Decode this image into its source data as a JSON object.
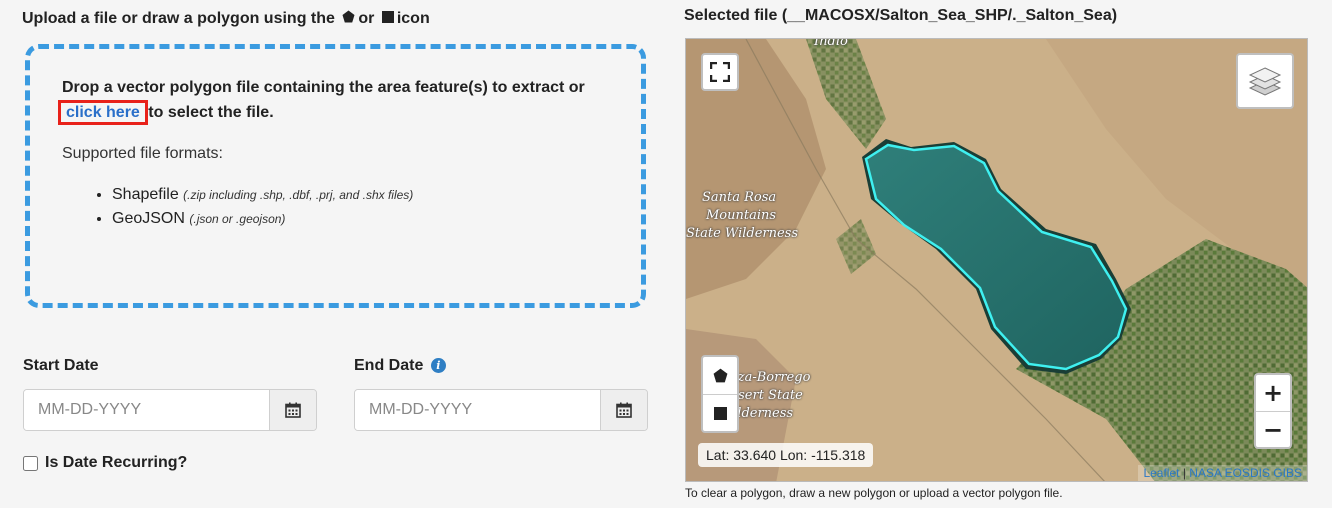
{
  "upload": {
    "heading_prefix": "Upload a file or draw a polygon using the",
    "heading_or": "or",
    "heading_suffix": "icon",
    "drop_text_before": "Drop a vector polygon file containing the area feature(s) to extract or ",
    "click_here": "click here",
    "drop_text_after": " to select the file.",
    "supported_formats_label": "Supported file formats:",
    "formats": [
      {
        "name": "Shapefile",
        "detail": "(.zip including .shp, .dbf, .prj, and .shx files)"
      },
      {
        "name": "GeoJSON",
        "detail": "(.json or .geojson)"
      }
    ]
  },
  "dates": {
    "start_label": "Start Date",
    "start_placeholder": "MM-DD-YYYY",
    "end_label": "End Date",
    "end_placeholder": "MM-DD-YYYY",
    "recurring_label": "Is Date Recurring?"
  },
  "map": {
    "selected_file_heading": "Selected file (__MACOSX/Salton_Sea_SHP/._Salton_Sea)",
    "labels": {
      "indio": "Indio",
      "santa_rosa": [
        "Santa Rosa",
        "Mountains",
        "State Wilderness"
      ],
      "anza_borrego": [
        "Anza-Borrego",
        "Desert State",
        "Wilderness"
      ]
    },
    "coordinates": "Lat: 33.640 Lon: -115.318",
    "zoom_in": "+",
    "zoom_out": "−",
    "attribution_leaflet": "Leaflet",
    "attribution_sep": " | ",
    "attribution_nasa": "NASA EOSDIS GIBS",
    "note": "To clear a polygon, draw a new polygon or upload a vector polygon file."
  },
  "colors": {
    "accent": "#3b9be0",
    "link": "#2a6fc9",
    "highlight_box": "#e8211a",
    "polygon_outline": "#3ff0f0",
    "info_icon": "#2f7fc4"
  },
  "icons": [
    "pentagon-icon",
    "square-icon",
    "info-icon",
    "calendar-icon",
    "fullscreen-icon",
    "layers-icon"
  ]
}
